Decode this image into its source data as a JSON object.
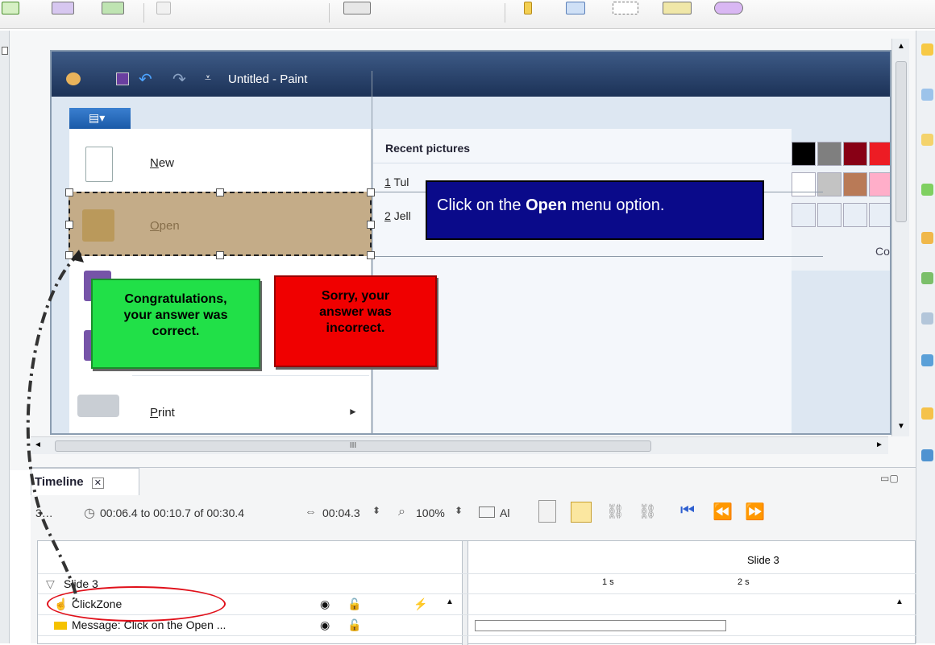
{
  "paint_window": {
    "title": "Untitled - Paint",
    "menu_items": [
      {
        "label": "New",
        "accel": "N"
      },
      {
        "label": "Open",
        "accel": "O"
      },
      {
        "label": "Print",
        "accel": "P"
      }
    ],
    "recent_title": "Recent pictures",
    "recent_items": [
      {
        "num": "1",
        "name": "Tul"
      },
      {
        "num": "2",
        "name": "Jell"
      }
    ],
    "colors_label": "Co",
    "palette": [
      "#000000",
      "#7f7f7f",
      "#880015",
      "#ed1c24",
      "#ffffff",
      "#c3c3c3",
      "#b97a57",
      "#ffaec9"
    ]
  },
  "captions": {
    "instruction_prefix": "Click on the ",
    "instruction_bold": "Open",
    "instruction_suffix": " menu option.",
    "success_lines": [
      "Congratulations,",
      "your answer was",
      "correct."
    ],
    "failure_lines": [
      "Sorry, your",
      "answer was",
      "incorrect."
    ]
  },
  "stage": {
    "hscroll_label": "III"
  },
  "timeline": {
    "tab_label": "Timeline",
    "slide_number_prefix": "3…",
    "time_range": "00:06.4 to 00:10.7 of 00:30.4",
    "duration": "00:04.3",
    "zoom": "100%",
    "align_label": "Al",
    "slide_header": "Slide 3",
    "tree_header": "Slide 3",
    "ruler_ticks": [
      "1 s",
      "2 s"
    ],
    "rows": [
      {
        "name": "ClickZone"
      },
      {
        "name": "Message: Click on the Open ..."
      }
    ]
  }
}
